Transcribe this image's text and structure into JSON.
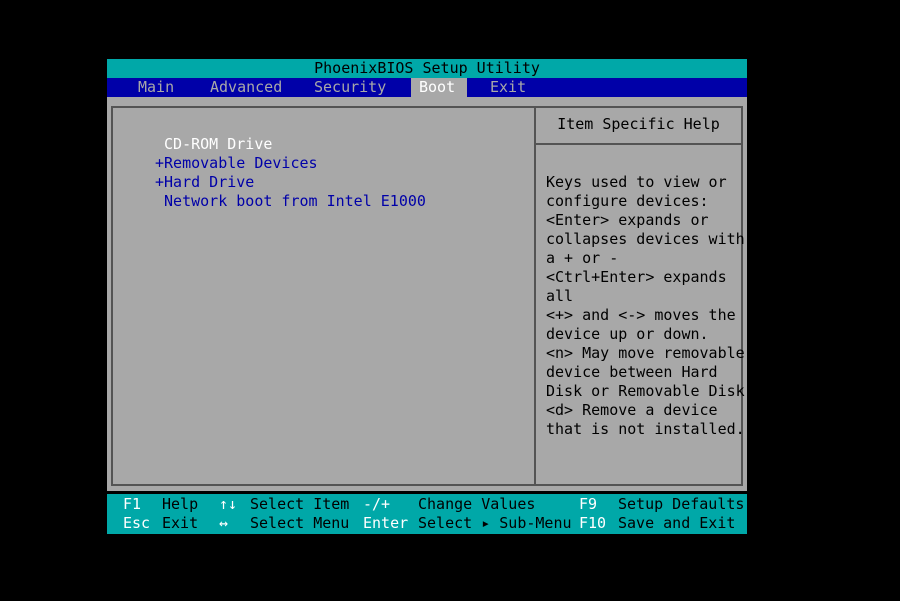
{
  "title": "PhoenixBIOS Setup Utility",
  "menu": {
    "tabs": [
      {
        "label": "Main"
      },
      {
        "label": "Advanced"
      },
      {
        "label": "Security"
      },
      {
        "label": "Boot",
        "active": true
      },
      {
        "label": "Exit"
      }
    ]
  },
  "boot_order": [
    {
      "label": " CD-ROM Drive",
      "selected": true
    },
    {
      "label": "+Removable Devices"
    },
    {
      "label": "+Hard Drive"
    },
    {
      "label": " Network boot from Intel E1000"
    }
  ],
  "help": {
    "title": "Item Specific Help",
    "lines": [
      "Keys used to view or",
      "configure devices:",
      "<Enter> expands or",
      "collapses devices with",
      "a + or -",
      "<Ctrl+Enter> expands",
      "all",
      "<+> and <-> moves the",
      "device up or down.",
      "<n> May move removable",
      "device between Hard",
      "Disk or Removable Disk",
      "<d> Remove a device",
      "that is not installed."
    ]
  },
  "footer": {
    "row1": [
      {
        "key": "F1",
        "desc": "Help"
      },
      {
        "key": "↑↓",
        "desc": "Select Item"
      },
      {
        "key": "-/+",
        "desc": "Change Values"
      },
      {
        "key": "F9",
        "desc": "Setup Defaults"
      }
    ],
    "row2": [
      {
        "key": "Esc",
        "desc": "Exit"
      },
      {
        "key": "↔",
        "desc": "Select Menu"
      },
      {
        "key": "Enter",
        "desc": "Select ▸ Sub-Menu"
      },
      {
        "key": "F10",
        "desc": "Save and Exit"
      }
    ]
  },
  "colors": {
    "cyan": "#00a8a8",
    "blue": "#0000a8",
    "gray": "#a8a8a8",
    "white": "#ffffff"
  }
}
